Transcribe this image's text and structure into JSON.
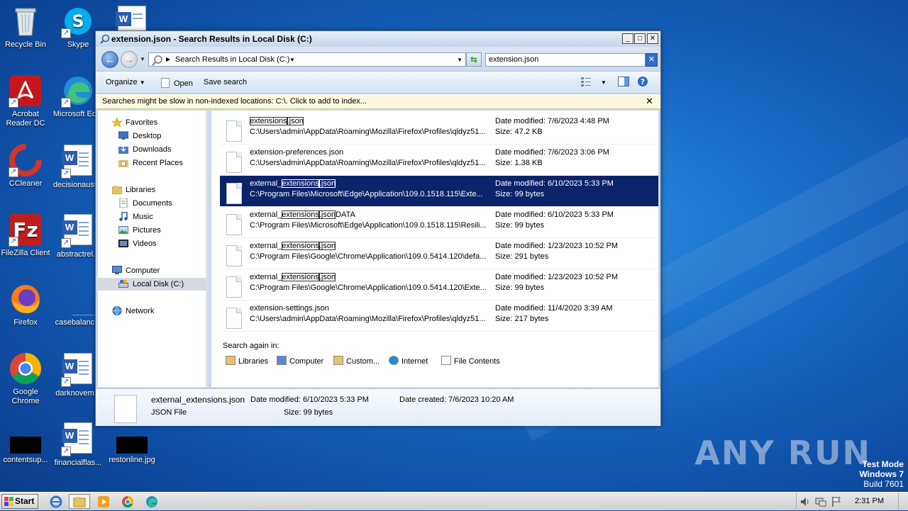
{
  "desktop": {
    "icons": [
      {
        "label": "Recycle Bin"
      },
      {
        "label": "Skype"
      },
      {
        "label": "Acrobat Reader DC"
      },
      {
        "label": "Microsoft Ed..."
      },
      {
        "label": "CCleaner"
      },
      {
        "label": "decisionaust..."
      },
      {
        "label": "FileZilla Client"
      },
      {
        "label": "abstractrel..."
      },
      {
        "label": "Firefox"
      },
      {
        "label": "casebalanc..."
      },
      {
        "label": "Google Chrome"
      },
      {
        "label": "darknovem..."
      },
      {
        "label": "contentsup..."
      },
      {
        "label": "financialflas..."
      },
      {
        "label": "restonline.jpg"
      }
    ],
    "watermark": "ANY RUN",
    "test_mode": {
      "line1": "Test Mode",
      "line2": "Windows 7",
      "line3": "Build 7601"
    }
  },
  "window": {
    "title": "extension.json - Search Results in Local Disk (C:)",
    "address": "Search Results in Local Disk (C:)",
    "search_value": "extension.json",
    "toolbar": {
      "organize": "Organize",
      "open": "Open",
      "save_search": "Save search"
    },
    "info_bar": "Searches might be slow in non-indexed locations: C:\\. Click to add to index...",
    "nav": {
      "favorites": "Favorites",
      "desktop": "Desktop",
      "downloads": "Downloads",
      "recent_places": "Recent Places",
      "libraries": "Libraries",
      "documents": "Documents",
      "music": "Music",
      "pictures": "Pictures",
      "videos": "Videos",
      "computer": "Computer",
      "local_disk": "Local Disk (C:)",
      "network": "Network"
    },
    "results": [
      {
        "name_pre": "",
        "name_hl": "extensions",
        "name_mid": "",
        "name_hl2": ".json",
        "name_post": "",
        "path": "C:\\Users\\admin\\AppData\\Roaming\\Mozilla\\Firefox\\Profiles\\qldyz51...",
        "date": "Date modified: 7/6/2023 4:48 PM",
        "size": "Size: 47.2 KB"
      },
      {
        "name_pre": "extension-preferences.json",
        "name_hl": "",
        "name_mid": "",
        "name_hl2": "",
        "name_post": "",
        "path": "C:\\Users\\admin\\AppData\\Roaming\\Mozilla\\Firefox\\Profiles\\qldyz51...",
        "date": "Date modified: 7/6/2023 3:06 PM",
        "size": "Size: 1.38 KB"
      },
      {
        "name_pre": "external_",
        "name_hl": "extensions",
        "name_mid": "",
        "name_hl2": ".json",
        "name_post": "",
        "path": "C:\\Program Files\\Microsoft\\Edge\\Application\\109.0.1518.115\\Exte...",
        "date": "Date modified: 6/10/2023 5:33 PM",
        "size": "Size: 99 bytes"
      },
      {
        "name_pre": "external_",
        "name_hl": "extensions",
        "name_mid": "",
        "name_hl2": ".json",
        "name_post": "DATA",
        "path": "C:\\Program Files\\Microsoft\\Edge\\Application\\109.0.1518.115\\Resili...",
        "date": "Date modified: 6/10/2023 5:33 PM",
        "size": "Size: 99 bytes"
      },
      {
        "name_pre": "external_",
        "name_hl": "extensions",
        "name_mid": "",
        "name_hl2": ".json",
        "name_post": "",
        "path": "C:\\Program Files\\Google\\Chrome\\Application\\109.0.5414.120\\defa...",
        "date": "Date modified: 1/23/2023 10:52 PM",
        "size": "Size: 291 bytes"
      },
      {
        "name_pre": "external_",
        "name_hl": "extensions",
        "name_mid": "",
        "name_hl2": ".json",
        "name_post": "",
        "path": "C:\\Program Files\\Google\\Chrome\\Application\\109.0.5414.120\\Exte...",
        "date": "Date modified: 1/23/2023 10:52 PM",
        "size": "Size: 99 bytes"
      },
      {
        "name_pre": "extension-settings.json",
        "name_hl": "",
        "name_mid": "",
        "name_hl2": "",
        "name_post": "",
        "path": "C:\\Users\\admin\\AppData\\Roaming\\Mozilla\\Firefox\\Profiles\\qldyz51...",
        "date": "Date modified: 11/4/2020 3:39 AM",
        "size": "Size: 217 bytes"
      }
    ],
    "search_again": {
      "label": "Search again in:",
      "libraries": "Libraries",
      "computer": "Computer",
      "custom": "Custom...",
      "internet": "Internet",
      "file_contents": "File Contents"
    },
    "details": {
      "name": "external_extensions.json",
      "type": "JSON File",
      "modified": "Date modified:  6/10/2023 5:33 PM",
      "size": "Size:  99 bytes",
      "created": "Date created:  7/6/2023 10:20 AM"
    }
  },
  "taskbar": {
    "start": "Start",
    "clock": "2:31 PM"
  },
  "colors": {
    "selection": "#0a246a",
    "info_bar": "#fbf8df",
    "desktop": "#1a6cc8"
  }
}
